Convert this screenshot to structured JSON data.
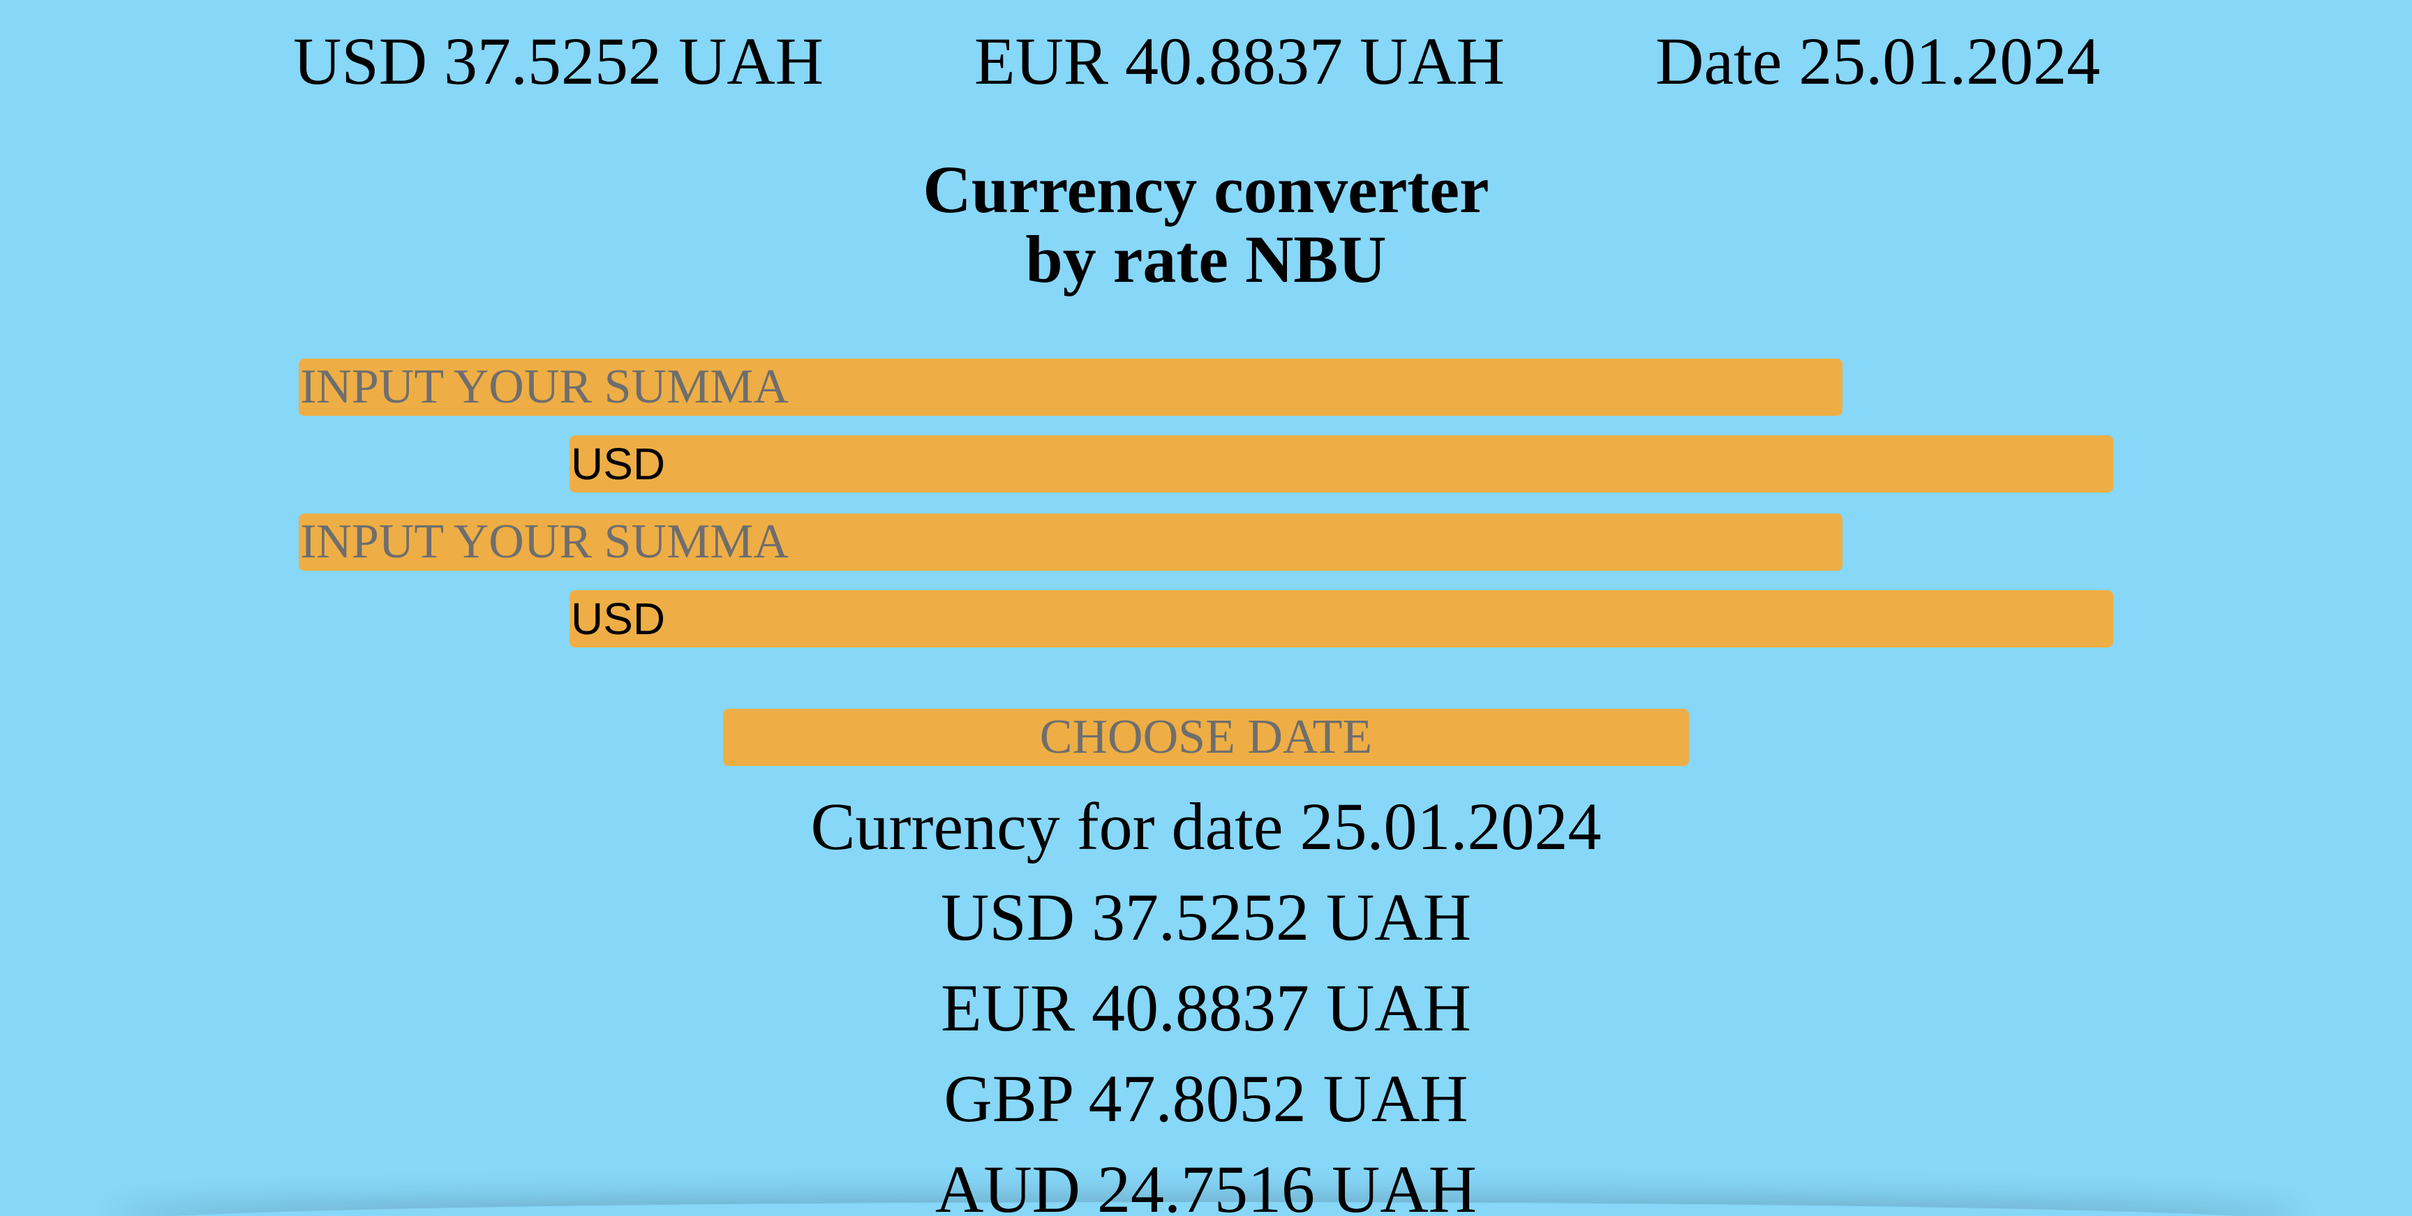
{
  "header": {
    "usd_rate": "USD 37.5252 UAH",
    "eur_rate": "EUR 40.8837 UAH",
    "date": "Date 25.01.2024"
  },
  "title": {
    "line1": "Currency converter",
    "line2": "by rate NBU"
  },
  "converter": {
    "sum_placeholder_1": "INPUT YOUR SUMMA",
    "currency_1": "USD",
    "sum_placeholder_2": "INPUT YOUR SUMMA",
    "currency_2": "USD"
  },
  "date_picker": {
    "label": "CHOOSE DATE"
  },
  "rates": {
    "heading": "Currency for date 25.01.2024",
    "items": [
      "USD 37.5252 UAH",
      "EUR 40.8837 UAH",
      "GBP 47.8052 UAH",
      "AUD 24.7516 UAH"
    ]
  },
  "colors": {
    "background": "#87d7f9",
    "control": "#eeae45",
    "placeholder_text": "#6e6e6e"
  }
}
